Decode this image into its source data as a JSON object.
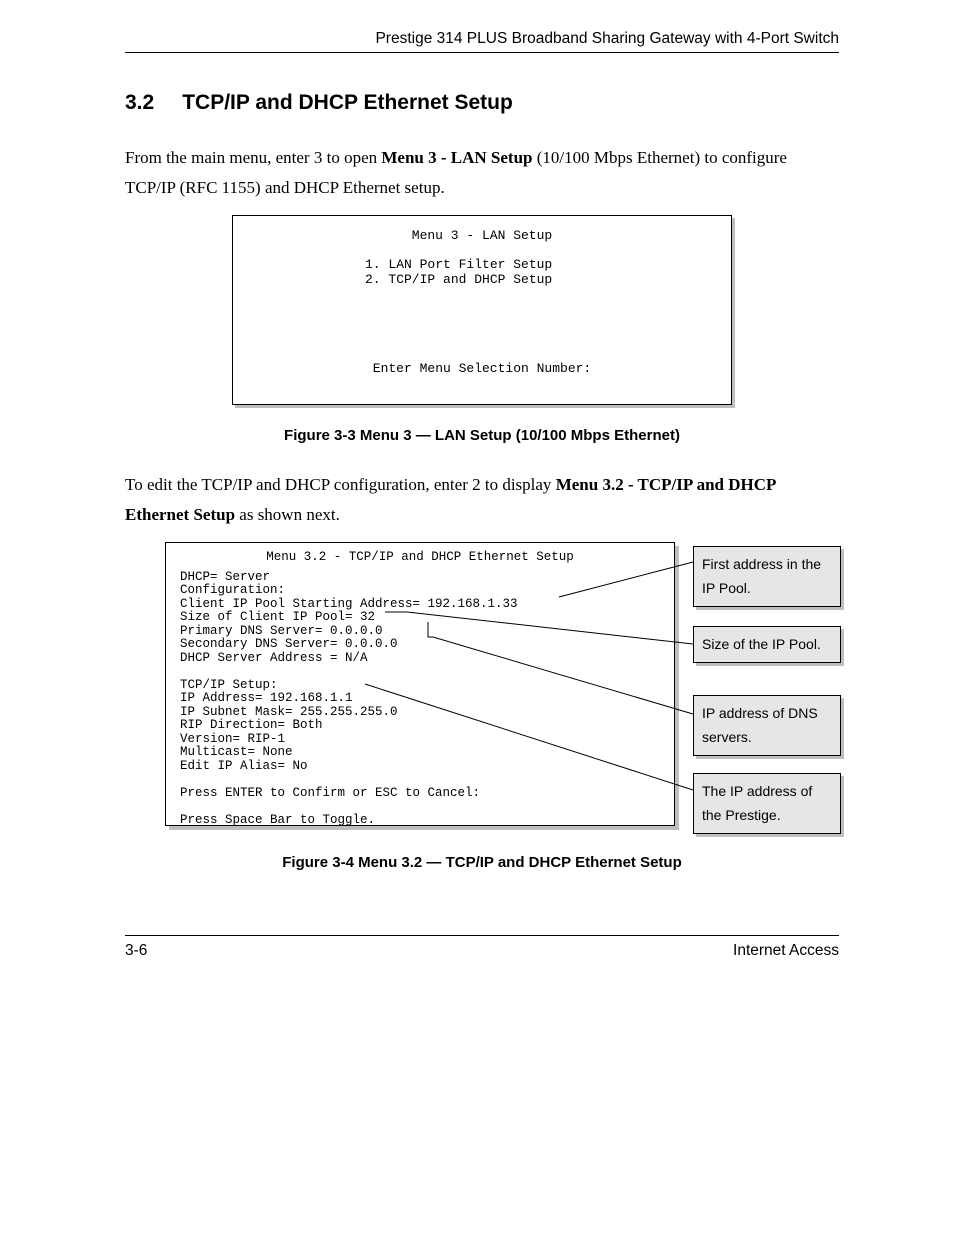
{
  "running_header": "Prestige 314 PLUS Broadband Sharing Gateway with 4-Port Switch",
  "section": {
    "number": "3.2",
    "title": "TCP/IP and DHCP Ethernet Setup"
  },
  "para1_pre": "From the main menu, enter 3 to open ",
  "para1_bold": "Menu 3 - LAN Setup",
  "para1_post": " (10/100 Mbps Ethernet) to configure TCP/IP (RFC 1155) and DHCP Ethernet setup.",
  "menu3": {
    "title": "Menu 3 - LAN Setup",
    "item1": "1. LAN Port Filter Setup",
    "item2": "2. TCP/IP and DHCP Setup",
    "prompt": "Enter Menu Selection Number:"
  },
  "fig33_caption": "Figure 3-3 Menu 3 — LAN Setup (10/100 Mbps Ethernet)",
  "para2_pre": "To edit the TCP/IP and DHCP configuration, enter 2 to display ",
  "para2_bold": "Menu 3.2 - TCP/IP and DHCP Ethernet Setup",
  "para2_post": " as shown next.",
  "menu32": {
    "title": "Menu 3.2 - TCP/IP and DHCP Ethernet Setup",
    "l1": "    DHCP= Server",
    "l2": "    Configuration:",
    "l3": "     Client IP Pool Starting Address= 192.168.1.33",
    "l4": "     Size of Client IP Pool= 32",
    "l5": "     Primary DNS Server= 0.0.0.0",
    "l6": "     Secondary DNS Server= 0.0.0.0",
    "l7": "     DHCP Server Address = N/A",
    "l8": "",
    "l9": "    TCP/IP Setup:",
    "l10": "     IP Address= 192.168.1.1",
    "l11": "     IP Subnet Mask= 255.255.255.0",
    "l12": "     RIP Direction= Both",
    "l13": "      Version= RIP-1",
    "l14": "     Multicast= None",
    "l15": "     Edit IP Alias= No",
    "l16": "",
    "l17": "     Press ENTER to Confirm or ESC to Cancel:",
    "l18": "",
    "l19": "Press Space Bar to Toggle."
  },
  "callouts": {
    "c1": "First address in the IP Pool.",
    "c2": "Size of the IP Pool.",
    "c3": "IP address of DNS servers.",
    "c4": "The IP address of the Prestige."
  },
  "fig34_caption": "Figure 3-4 Menu 3.2 — TCP/IP and DHCP Ethernet Setup",
  "footer": {
    "left": "3-6",
    "right": "Internet Access"
  }
}
